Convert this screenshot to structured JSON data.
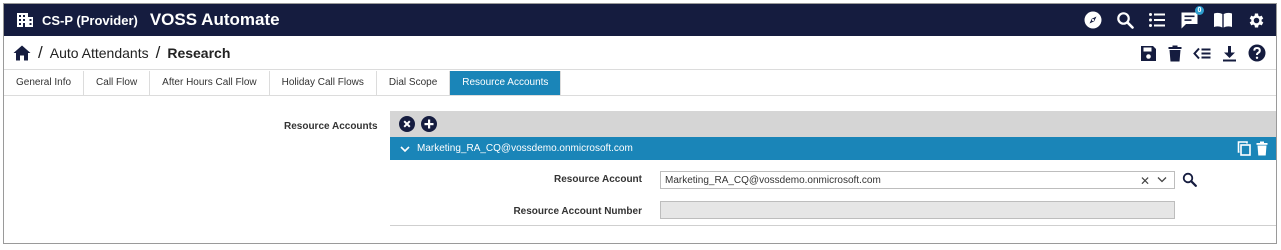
{
  "topbar": {
    "tenant": "CS-P (Provider)",
    "brand": "VOSS Automate",
    "icons": [
      "building-icon",
      "compass-icon",
      "search-icon",
      "list-icon",
      "chat-icon",
      "book-icon",
      "gear-icon"
    ],
    "notification_count": "0"
  },
  "breadcrumb": {
    "items": [
      "Auto Attendants",
      "Research"
    ],
    "separator": "/"
  },
  "toolbar": {
    "icons": [
      "save-icon",
      "delete-icon",
      "collapse-list-icon",
      "download-icon",
      "help-icon"
    ]
  },
  "tabs": [
    {
      "label": "General Info",
      "active": false
    },
    {
      "label": "Call Flow",
      "active": false
    },
    {
      "label": "After Hours Call Flow",
      "active": false
    },
    {
      "label": "Holiday Call Flows",
      "active": false
    },
    {
      "label": "Dial Scope",
      "active": false
    },
    {
      "label": "Resource Accounts",
      "active": true
    }
  ],
  "section": {
    "label": "Resource Accounts",
    "item": {
      "title": "Marketing_RA_CQ@vossdemo.onmicrosoft.com",
      "fields": {
        "account_label": "Resource Account",
        "account_value": "Marketing_RA_CQ@vossdemo.onmicrosoft.com",
        "number_label": "Resource Account Number",
        "number_value": ""
      }
    }
  },
  "colors": {
    "navbar": "#151c3f",
    "accent": "#1a85b8",
    "panel_header": "#d5d5d5"
  }
}
